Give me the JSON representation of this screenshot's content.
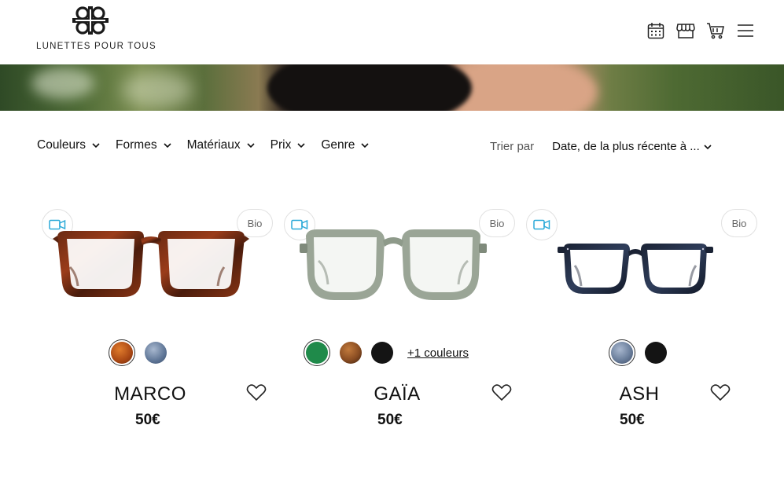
{
  "header": {
    "logo_text": "LUNETTES POUR TOUS",
    "icons": [
      "calendar-icon",
      "store-icon",
      "cart-icon",
      "menu-icon"
    ]
  },
  "filters": [
    {
      "label": "Couleurs"
    },
    {
      "label": "Formes"
    },
    {
      "label": "Matériaux"
    },
    {
      "label": "Prix"
    },
    {
      "label": "Genre"
    }
  ],
  "sort": {
    "label": "Trier par",
    "value": "Date, de la plus récente à ..."
  },
  "products": [
    {
      "name": "MARCO",
      "price": "50€",
      "badge": "Bio",
      "swatches": [
        {
          "color": "#b3561e",
          "selected": true
        },
        {
          "color": "#6f84a3",
          "selected": false
        }
      ]
    },
    {
      "name": "GAÏA",
      "price": "50€",
      "badge": "Bio",
      "swatches": [
        {
          "color": "#1f8a4a",
          "selected": true
        },
        {
          "color": "#8a4d22",
          "selected": false
        },
        {
          "color": "#141414",
          "selected": false
        }
      ],
      "more_colors": "+1 couleurs"
    },
    {
      "name": "ASH",
      "price": "50€",
      "badge": "Bio",
      "swatches": [
        {
          "color": "#6b7f9c",
          "selected": true
        },
        {
          "color": "#141414",
          "selected": false
        }
      ]
    }
  ],
  "colors": {
    "accent_video": "#2aa9d8",
    "text": "#111111",
    "border": "#e1e1e1"
  }
}
